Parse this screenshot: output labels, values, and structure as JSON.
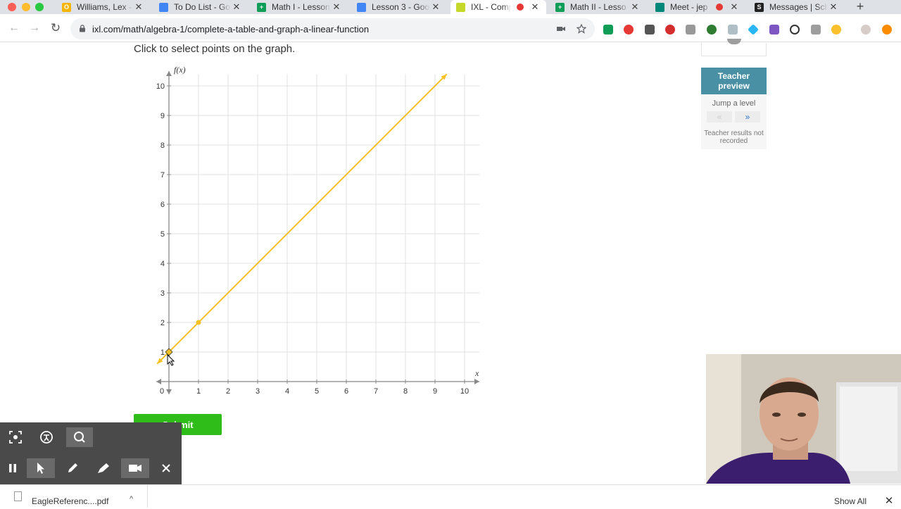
{
  "browser": {
    "tabs": [
      {
        "title": "Williams, Lex - ",
        "favicon_color": "#f7b500",
        "favicon_glyph": "O",
        "active": false,
        "recording": false
      },
      {
        "title": "To Do List - Goo",
        "favicon_color": "#4285f4",
        "favicon_glyph": "",
        "active": false,
        "recording": false
      },
      {
        "title": "Math I - Lesson",
        "favicon_color": "#0f9d58",
        "favicon_glyph": "+",
        "active": false,
        "recording": false
      },
      {
        "title": "Lesson 3 - Goo",
        "favicon_color": "#4285f4",
        "favicon_glyph": "",
        "active": false,
        "recording": false
      },
      {
        "title": "IXL - Compl",
        "favicon_color": "#c6d92b",
        "favicon_glyph": "",
        "active": true,
        "recording": true
      },
      {
        "title": "Math II - Lesso",
        "favicon_color": "#0f9d58",
        "favicon_glyph": "+",
        "active": false,
        "recording": false
      },
      {
        "title": "Meet - jep",
        "favicon_color": "#00897b",
        "favicon_glyph": "",
        "active": false,
        "recording": true
      },
      {
        "title": "Messages | Sch",
        "favicon_color": "#222222",
        "favicon_glyph": "S",
        "active": false,
        "recording": false
      }
    ],
    "new_tab_glyph": "+",
    "close_glyph": "✕",
    "url": "ixl.com/math/algebra-1/complete-a-table-and-graph-a-linear-function",
    "back_glyph": "←",
    "forward_glyph": "→",
    "reload_glyph": "↻"
  },
  "page": {
    "instruction": "Click to select points on the graph.",
    "submit_label": "Submit"
  },
  "chart_data": {
    "type": "line",
    "xlabel": "x",
    "ylabel": "f(x)",
    "xlim": [
      0,
      10
    ],
    "ylim": [
      0,
      10
    ],
    "x_ticks": [
      0,
      1,
      2,
      3,
      4,
      5,
      6,
      7,
      8,
      9,
      10
    ],
    "y_ticks": [
      1,
      2,
      3,
      4,
      5,
      6,
      7,
      8,
      9,
      10
    ],
    "grid": true,
    "line_color": "#f5c023",
    "series": [
      {
        "x": [
          -0.4,
          9.4
        ],
        "y": [
          0.6,
          10.4
        ]
      }
    ],
    "points": [
      {
        "x": 0,
        "y": 1
      },
      {
        "x": 1,
        "y": 2
      }
    ]
  },
  "sidebar": {
    "teacher_preview_label": "Teacher preview",
    "jump_label": "Jump a level",
    "jump_prev_glyph": "«",
    "jump_next_glyph": "»",
    "not_recorded": "Teacher results not recorded"
  },
  "recorder": {
    "icons": [
      "screenshot-icon",
      "accessibility-icon",
      "zoom-icon",
      "pause-icon",
      "cursor-icon",
      "pen-icon",
      "highlighter-icon",
      "camera-icon",
      "close-icon"
    ]
  },
  "downloads": {
    "file_name": "EagleReferenc....pdf",
    "show_all": "Show All",
    "close_glyph": "✕",
    "chevron_glyph": "^"
  }
}
